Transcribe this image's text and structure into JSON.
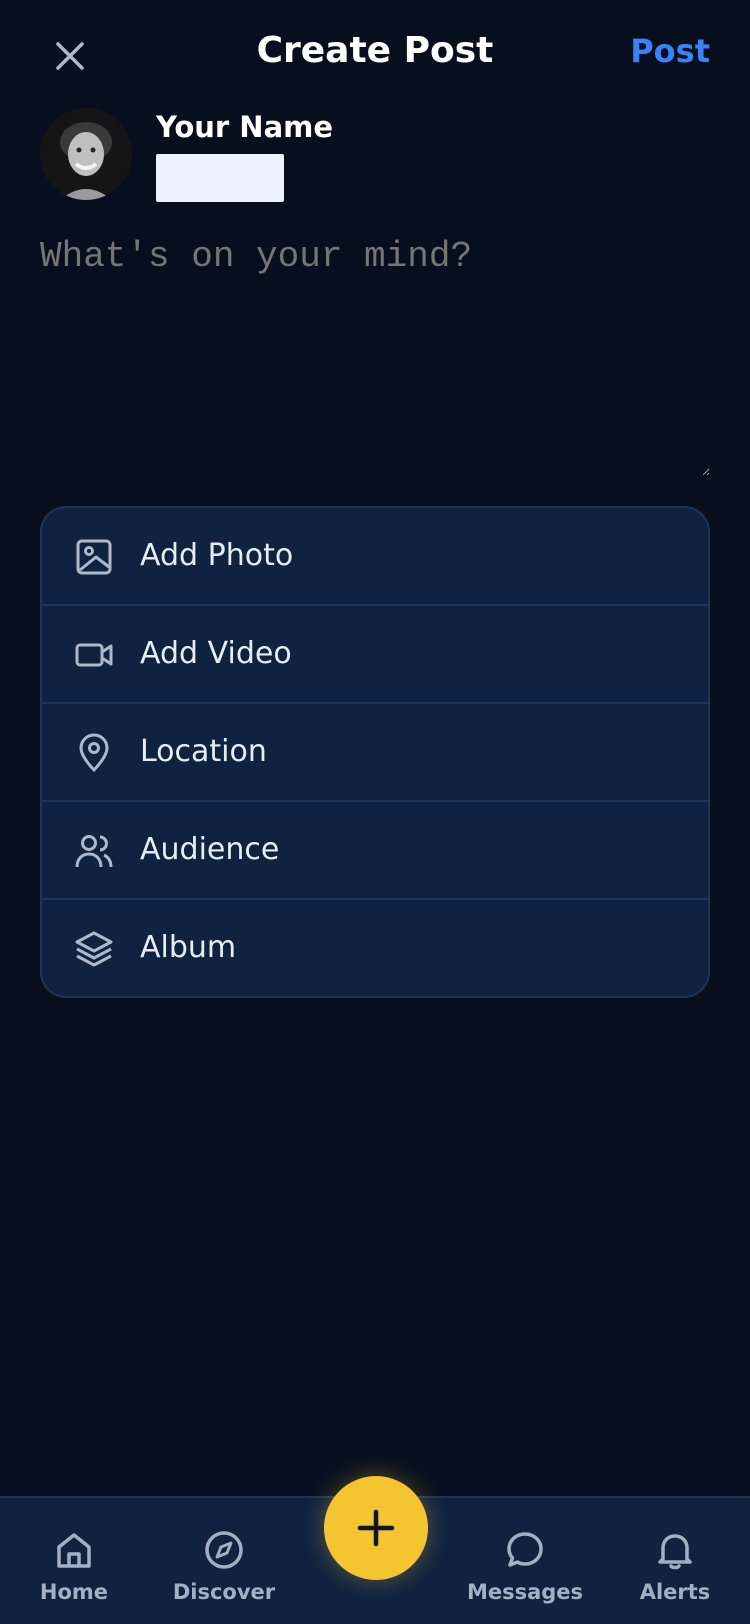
{
  "header": {
    "title": "Create Post",
    "post_label": "Post",
    "close_icon": "close-icon"
  },
  "profile": {
    "name": "Your Name"
  },
  "composer": {
    "placeholder": "What's on your mind?"
  },
  "options": [
    {
      "label": "Add Photo",
      "icon": "image-icon"
    },
    {
      "label": "Add Video",
      "icon": "video-icon"
    },
    {
      "label": "Location",
      "icon": "location-pin-icon"
    },
    {
      "label": "Audience",
      "icon": "users-icon"
    },
    {
      "label": "Album",
      "icon": "layers-icon"
    }
  ],
  "nav": {
    "items": [
      {
        "label": "Home",
        "icon": "home-icon"
      },
      {
        "label": "Discover",
        "icon": "compass-icon"
      },
      {
        "label": "Messages",
        "icon": "chat-bubble-icon"
      },
      {
        "label": "Alerts",
        "icon": "bell-icon"
      }
    ],
    "fab_icon": "plus-icon"
  },
  "colors": {
    "background": "#070f1f",
    "card": "#0f2240",
    "accent": "#3b82f6",
    "fab": "#f5c431"
  }
}
